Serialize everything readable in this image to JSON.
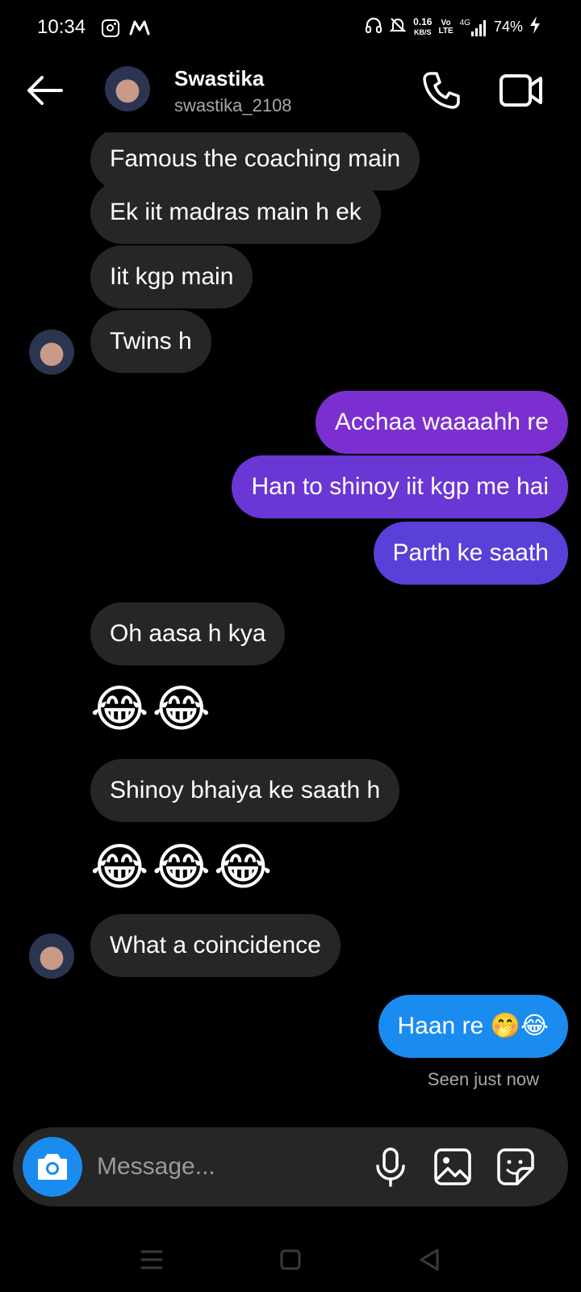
{
  "status_bar": {
    "time": "10:34",
    "net_speed_value": "0.16",
    "net_speed_unit": "KB/S",
    "volte_top": "Vo",
    "volte_bottom": "LTE",
    "network": "4G",
    "battery": "74%",
    "icons": [
      "instagram-icon",
      "myntra-icon",
      "headphones-icon",
      "mute-icon",
      "signal-icon",
      "charging-icon"
    ]
  },
  "header": {
    "contact_name": "Swastika",
    "contact_handle": "swastika_2108",
    "icons": [
      "back-arrow-icon",
      "phone-icon",
      "video-camera-icon"
    ]
  },
  "messages": [
    {
      "id": "m1",
      "direction": "incoming",
      "text": "Famous the coaching main"
    },
    {
      "id": "m2",
      "direction": "incoming",
      "text": "Ek iit madras main h ek"
    },
    {
      "id": "m3",
      "direction": "incoming",
      "text": "Iit kgp main"
    },
    {
      "id": "m4",
      "direction": "incoming",
      "text": "Twins h"
    },
    {
      "id": "m5",
      "direction": "outgoing",
      "text": "Acchaa waaaahh re"
    },
    {
      "id": "m6",
      "direction": "outgoing",
      "text": "Han to shinoy iit kgp me hai"
    },
    {
      "id": "m7",
      "direction": "outgoing",
      "text": "Parth ke saath"
    },
    {
      "id": "m8",
      "direction": "incoming",
      "text": "Oh aasa h kya"
    },
    {
      "id": "m9",
      "direction": "incoming",
      "text": "😂😂"
    },
    {
      "id": "m10",
      "direction": "incoming",
      "text": "Shinoy bhaiya ke saath h"
    },
    {
      "id": "m11",
      "direction": "incoming",
      "text": "😂😂😂"
    },
    {
      "id": "m12",
      "direction": "incoming",
      "text": "What a coincidence"
    },
    {
      "id": "m13",
      "direction": "outgoing",
      "text": "Haan re 🤭😂"
    }
  ],
  "seen_status": "Seen just now",
  "composer": {
    "placeholder": "Message...",
    "icons": [
      "camera-icon",
      "microphone-icon",
      "gallery-icon",
      "sticker-icon"
    ]
  },
  "nav_bar": {
    "icons": [
      "menu-icon",
      "home-icon",
      "back-icon"
    ]
  },
  "colors": {
    "background": "#000000",
    "incoming_bubble": "#262626",
    "outgoing_gradient_top": "#7b2fd0",
    "outgoing_gradient_bottom": "#5a3fd8",
    "outgoing_blue": "#1a8cf0",
    "camera_button": "#1a8cf0",
    "secondary_text": "#a8a8a8"
  }
}
